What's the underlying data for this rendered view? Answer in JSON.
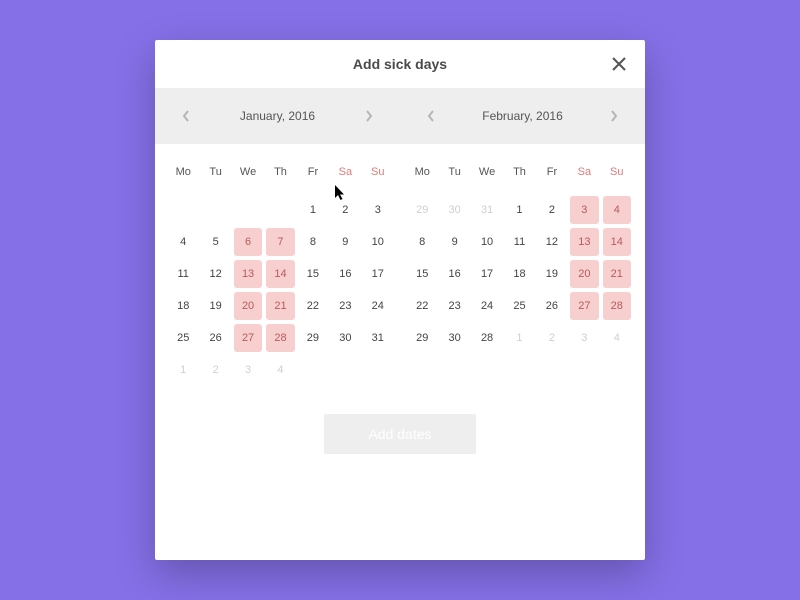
{
  "header": {
    "title": "Add sick days"
  },
  "weekdays": [
    "Mo",
    "Tu",
    "We",
    "Th",
    "Fr",
    "Sa",
    "Su"
  ],
  "months": [
    {
      "label": "January, 2016",
      "offset": 4,
      "days": [
        {
          "n": 1
        },
        {
          "n": 2
        },
        {
          "n": 3
        },
        {
          "n": 4
        },
        {
          "n": 5
        },
        {
          "n": 6,
          "hl": true
        },
        {
          "n": 7,
          "hl": true
        },
        {
          "n": 8
        },
        {
          "n": 9
        },
        {
          "n": 10
        },
        {
          "n": 11
        },
        {
          "n": 12
        },
        {
          "n": 13,
          "hl": true
        },
        {
          "n": 14,
          "hl": true
        },
        {
          "n": 15
        },
        {
          "n": 16
        },
        {
          "n": 17
        },
        {
          "n": 18
        },
        {
          "n": 19
        },
        {
          "n": 20,
          "hl": true
        },
        {
          "n": 21,
          "hl": true
        },
        {
          "n": 22
        },
        {
          "n": 23
        },
        {
          "n": 24
        },
        {
          "n": 25
        },
        {
          "n": 26
        },
        {
          "n": 27,
          "hl": true
        },
        {
          "n": 28,
          "hl": true
        },
        {
          "n": 29
        },
        {
          "n": 30
        },
        {
          "n": 31
        },
        {
          "n": 1,
          "muted": true
        },
        {
          "n": 2,
          "muted": true
        },
        {
          "n": 3,
          "muted": true
        },
        {
          "n": 4,
          "muted": true
        }
      ]
    },
    {
      "label": "February, 2016",
      "offset": 0,
      "days": [
        {
          "n": 29,
          "muted": true
        },
        {
          "n": 30,
          "muted": true
        },
        {
          "n": 31,
          "muted": true
        },
        {
          "n": 1
        },
        {
          "n": 2
        },
        {
          "n": 3,
          "hl": true
        },
        {
          "n": 4,
          "hl": true
        },
        {
          "n": 8
        },
        {
          "n": 9
        },
        {
          "n": 10
        },
        {
          "n": 11
        },
        {
          "n": 12
        },
        {
          "n": 13,
          "hl": true
        },
        {
          "n": 14,
          "hl": true
        },
        {
          "n": 15
        },
        {
          "n": 16
        },
        {
          "n": 17
        },
        {
          "n": 18
        },
        {
          "n": 19
        },
        {
          "n": 20,
          "hl": true
        },
        {
          "n": 21,
          "hl": true
        },
        {
          "n": 22
        },
        {
          "n": 23
        },
        {
          "n": 24
        },
        {
          "n": 25
        },
        {
          "n": 26
        },
        {
          "n": 27,
          "hl": true
        },
        {
          "n": 28,
          "hl": true
        },
        {
          "n": 29
        },
        {
          "n": 30
        },
        {
          "n": 28
        },
        {
          "n": 1,
          "muted": true
        },
        {
          "n": 2,
          "muted": true
        },
        {
          "n": 3,
          "muted": true
        },
        {
          "n": 4,
          "muted": true
        }
      ]
    }
  ],
  "actions": {
    "add_label": "Add dates"
  }
}
